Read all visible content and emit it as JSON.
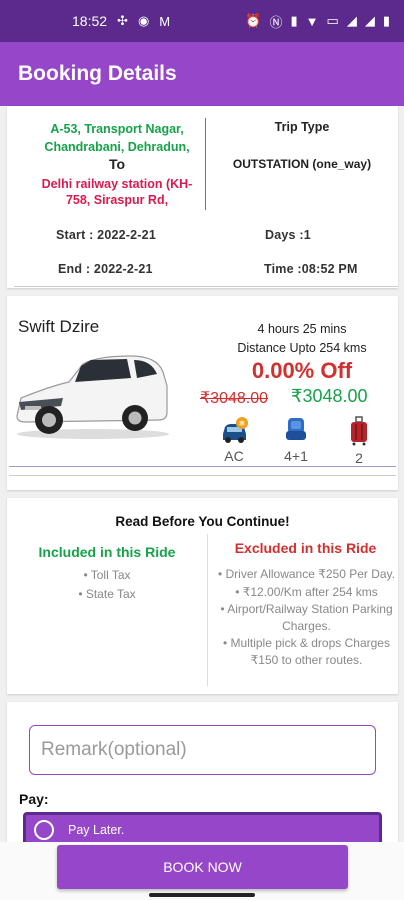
{
  "status_bar": {
    "time": "18:52"
  },
  "app_bar": {
    "title": "Booking Details"
  },
  "route": {
    "from": "A-53, Transport Nagar, Chandrabani, Dehradun,",
    "to_label": "To",
    "destination": "Delhi railway station (KH-758, Siraspur Rd,",
    "trip_type_label": "Trip Type",
    "trip_type_value": "OUTSTATION (one_way)",
    "start": "Start :  2022-2-21",
    "days": "Days :1",
    "end": "End :  2022-2-21",
    "time": "Time :08:52 PM"
  },
  "car": {
    "name": "Swift Dzire",
    "duration": "4 hours 25 mins",
    "distance": "Distance Upto 254 kms",
    "discount": "0.00% Off",
    "old_price": "₹3048.00",
    "new_price": "₹3048.00",
    "features": [
      {
        "icon": "ac-car-icon",
        "label": "AC"
      },
      {
        "icon": "seat-icon",
        "label": "4+1"
      },
      {
        "icon": "luggage-icon",
        "label": "2"
      }
    ]
  },
  "policy": {
    "title": "Read Before You Continue!",
    "included_title": "Included in this Ride",
    "included": [
      "• Toll Tax",
      "• State Tax"
    ],
    "excluded_title": "Excluded in this Ride",
    "excluded": [
      "• Driver Allowance ₹250 Per Day.",
      "• ₹12.00/Km after 254 kms",
      "• Airport/Railway Station Parking Charges.",
      "• Multiple pick & drops Charges ₹150 to other routes."
    ]
  },
  "remark": {
    "placeholder": "Remark(optional)"
  },
  "pay": {
    "label": "Pay:",
    "option": "Pay Later."
  },
  "book_button": "BOOK NOW",
  "colors": {
    "primary": "#9646c8",
    "status_bar": "#5b2a8c",
    "green": "#17a24a",
    "red": "#d32f2f"
  }
}
